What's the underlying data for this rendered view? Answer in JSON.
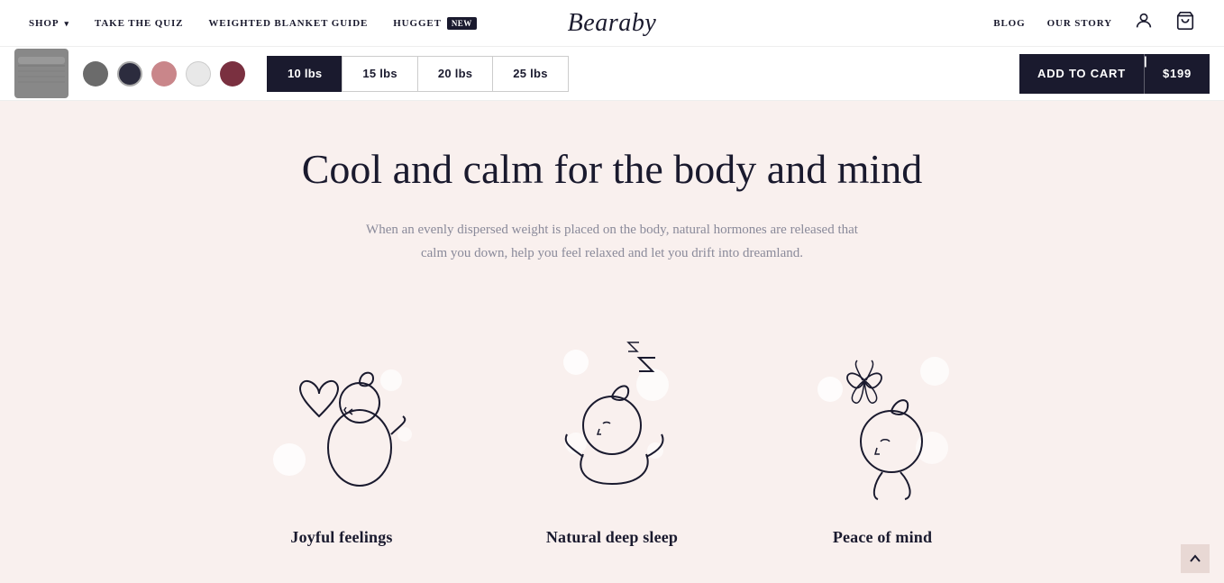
{
  "header": {
    "nav_left": [
      {
        "label": "SHOP",
        "id": "shop",
        "has_dropdown": true
      },
      {
        "label": "TAKE THE QUIZ",
        "id": "take-the-quiz"
      },
      {
        "label": "WEIGHTED BLANKET GUIDE",
        "id": "weighted-blanket-guide"
      },
      {
        "label": "HUGGET",
        "id": "hugget",
        "badge": "NEW"
      }
    ],
    "logo": "Bearaby",
    "nav_right": [
      {
        "label": "BLOG",
        "id": "blog"
      },
      {
        "label": "OUR STORY",
        "id": "our-story"
      }
    ]
  },
  "sticky_bar": {
    "swatches": [
      {
        "color": "#6b6b6b",
        "id": "charcoal"
      },
      {
        "color": "#2c2c3e",
        "id": "navy"
      },
      {
        "color": "#c9868a",
        "id": "blush"
      },
      {
        "color": "#e8e8e8",
        "id": "white"
      },
      {
        "color": "#7a3040",
        "id": "merlot"
      }
    ],
    "weights": [
      {
        "label": "10 lbs",
        "active": true
      },
      {
        "label": "15 lbs",
        "active": false
      },
      {
        "label": "20 lbs",
        "active": false
      },
      {
        "label": "25 lbs",
        "active": false
      }
    ],
    "add_to_cart_label": "ADD TO CART",
    "price": "$199"
  },
  "main": {
    "title": "Cool and calm for the body and mind",
    "subtitle": "When an evenly dispersed weight is placed on the body, natural hormones are released that calm you down, help you feel relaxed and let you drift into dreamland.",
    "features": [
      {
        "label": "Joyful feelings",
        "icon": "joyful"
      },
      {
        "label": "Natural deep sleep",
        "icon": "sleep"
      },
      {
        "label": "Peace of mind",
        "icon": "peace"
      }
    ]
  }
}
